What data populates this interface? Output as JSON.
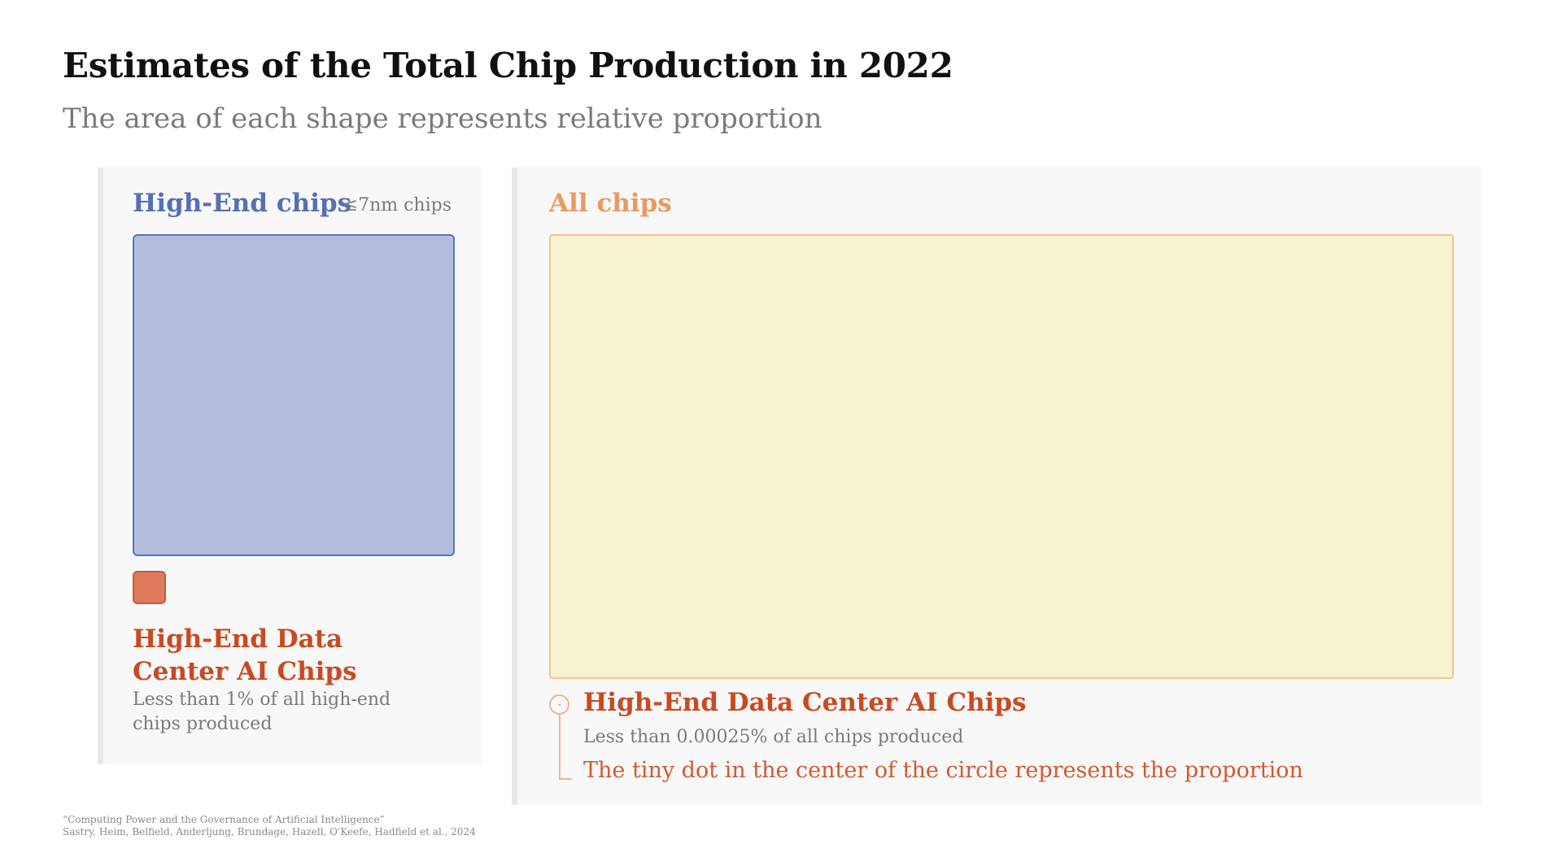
{
  "title": "Estimates of the Total Chip Production in 2022",
  "subtitle": "The area of each shape represents relative proportion",
  "left_panel": {
    "title": "High-End chips",
    "note": "≤7nm chips",
    "ai_title": "High-End Data Center AI Chips",
    "ai_description": "Less than 1% of all high-end chips produced"
  },
  "right_panel": {
    "title": "All chips",
    "ai_title": "High-End Data Center AI Chips",
    "ai_description": "Less than 0.00025% of all chips produced",
    "ai_note": "The tiny dot in the center of the circle represents the proportion"
  },
  "colors": {
    "high_end": "#b2bddd",
    "high_end_border": "#5a72b8",
    "ai_chips": "#df7b5b",
    "all_chips": "#f7f2cf",
    "all_chips_border": "#f4c494",
    "ai_text": "#c94a22"
  },
  "source": {
    "line1": "“Computing Power and the Governance of Artificial Intelligence”",
    "line2": "Sastry, Heim, Belfield, Anderljung, Brundage, Hazell, O'Keefe, Hadfield et al., 2024"
  }
}
